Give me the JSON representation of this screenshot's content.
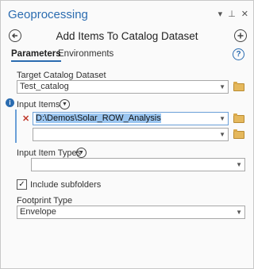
{
  "app_title": "Geoprocessing",
  "tool_title": "Add Items To Catalog Dataset",
  "tabs": {
    "parameters": "Parameters",
    "environments": "Environments"
  },
  "help_glyph": "?",
  "target_dataset": {
    "label": "Target Catalog Dataset",
    "value": "Test_catalog"
  },
  "input_items": {
    "label": "Input Items",
    "row1_value": "D:\\Demos\\Solar_ROW_Analysis",
    "row2_value": ""
  },
  "input_item_types": {
    "label": "Input Item Types",
    "value": ""
  },
  "include_subfolders": {
    "label": "Include subfolders",
    "checked": true
  },
  "footprint_type": {
    "label": "Footprint Type",
    "value": "Envelope"
  },
  "icons": {
    "titlebar": [
      "chevron-down-icon",
      "pin-icon",
      "close-icon"
    ]
  }
}
